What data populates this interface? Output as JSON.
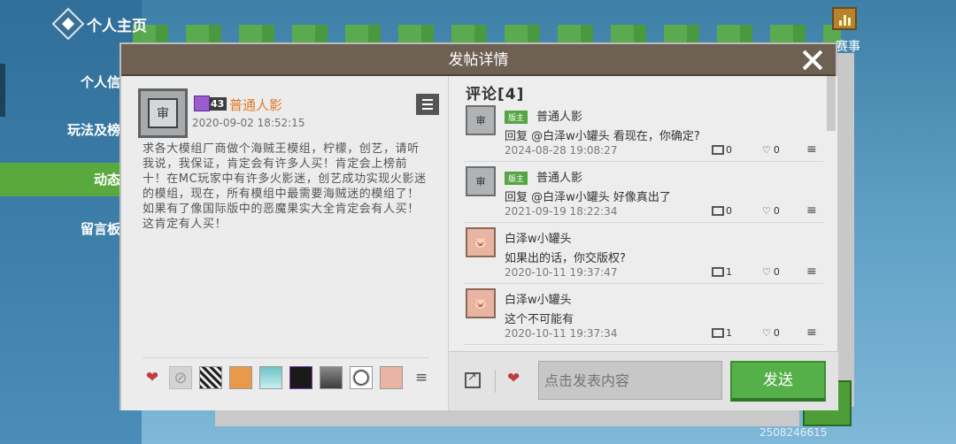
{
  "background": {
    "header_title": "个人主页",
    "nav_items": [
      "个人信",
      "玩法及榜",
      "动态",
      "留言板"
    ],
    "right_label": "赛事",
    "bottom_id": "2508246615"
  },
  "dialog": {
    "title": "发帖详情"
  },
  "post": {
    "author": {
      "level": "43",
      "name": "普通人影",
      "avatar": "审"
    },
    "time": "2020-09-02 18:52:15",
    "body": "求各大模组厂商做个海贼王模组，柠檬，创艺，请听我说，我保证，肯定会有许多人买！肯定会上榜前十！在MC玩家中有许多火影迷，创艺成功实现火影迷的模组，现在，所有模组中最需要海贼迷的模组了！如果有了像国际版中的恶魔果实大全肯定会有人买！这肯定有人买！"
  },
  "comments": {
    "title": "评论[4]",
    "items": [
      {
        "is_mod": true,
        "mod_label": "版主",
        "name": "普通人影",
        "text": "回复 @白泽w小罐头 看现在，你确定?",
        "time": "2024-08-28 19:08:27",
        "replies": "0",
        "likes": "0",
        "avatar": "审"
      },
      {
        "is_mod": true,
        "mod_label": "版主",
        "name": "普通人影",
        "text": "回复 @白泽w小罐头 好像真出了",
        "time": "2021-09-19 18:22:34",
        "replies": "0",
        "likes": "0",
        "avatar": "审"
      },
      {
        "is_mod": false,
        "mod_label": "",
        "name": "白泽w小罐头",
        "text": "如果出的话，你交版权?",
        "time": "2020-10-11 19:37:47",
        "replies": "1",
        "likes": "0",
        "avatar": "🐷"
      },
      {
        "is_mod": false,
        "mod_label": "",
        "name": "白泽w小罐头",
        "text": "这个不可能有",
        "time": "2020-10-11 19:37:34",
        "replies": "1",
        "likes": "0",
        "avatar": "🐷"
      }
    ]
  },
  "compose": {
    "placeholder": "点击发表内容",
    "send_label": "发送"
  },
  "icons": {
    "close": "close-icon",
    "menu": "menu-icon",
    "heart": "heart-icon",
    "reply": "comment-bubble-icon",
    "like": "heart-outline-icon",
    "share": "external-link-icon"
  },
  "colors": {
    "title_bar": "#6e6052",
    "author_name": "#e07b2a",
    "mod_badge": "#54a544",
    "send_button": "#55b04a",
    "heart": "#c43b3b"
  }
}
